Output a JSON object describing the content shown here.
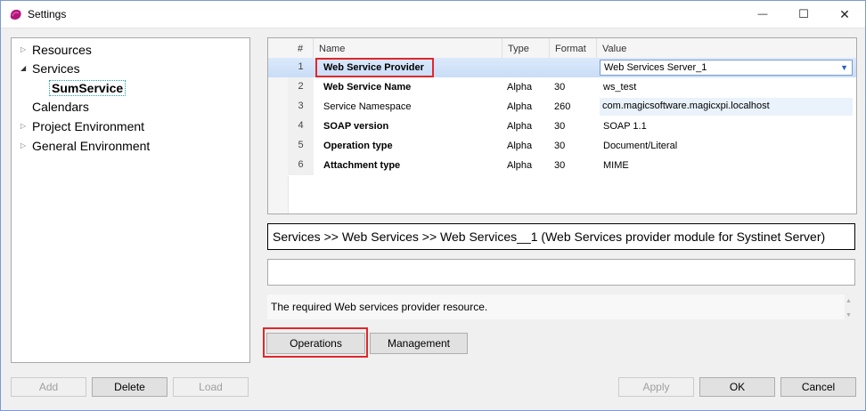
{
  "window": {
    "title": "Settings",
    "minimize": "—",
    "maximize": "☐",
    "close": "✕"
  },
  "tree": {
    "items": [
      {
        "label": "Resources",
        "expander": "▷"
      },
      {
        "label": "Services",
        "expander": "◢"
      },
      {
        "label": "SumService",
        "expander": ""
      },
      {
        "label": "Calendars",
        "expander": ""
      },
      {
        "label": "Project Environment",
        "expander": "▷"
      },
      {
        "label": "General Environment",
        "expander": "▷"
      }
    ]
  },
  "grid": {
    "headers": {
      "num": "#",
      "name": "Name",
      "type": "Type",
      "format": "Format",
      "value": "Value"
    },
    "rows": [
      {
        "num": "1",
        "name": "Web Service Provider",
        "type": "",
        "format": "",
        "value": "Web Services Server_1"
      },
      {
        "num": "2",
        "name": "Web Service Name",
        "type": "Alpha",
        "format": "30",
        "value": "ws_test"
      },
      {
        "num": "3",
        "name": "Service Namespace",
        "type": "Alpha",
        "format": "260",
        "value": "com.magicsoftware.magicxpi.localhost"
      },
      {
        "num": "4",
        "name": "SOAP version",
        "type": "Alpha",
        "format": "30",
        "value": "SOAP 1.1"
      },
      {
        "num": "5",
        "name": "Operation type",
        "type": "Alpha",
        "format": "30",
        "value": "Document/Literal"
      },
      {
        "num": "6",
        "name": "Attachment type",
        "type": "Alpha",
        "format": "30",
        "value": "MIME"
      }
    ]
  },
  "path_text": "Services >> Web Services >> Web Services__1 (Web Services provider module for Systinet Server)",
  "empty_field": "",
  "description": "The required Web services provider resource.",
  "buttons": {
    "operations": "Operations",
    "management": "Management",
    "add": "Add",
    "delete": "Delete",
    "load": "Load",
    "apply": "Apply",
    "ok": "OK",
    "cancel": "Cancel"
  },
  "colors": {
    "highlight": "#e0282c",
    "selected_row": "#c9ddf7",
    "accent": "#2b62b8"
  }
}
